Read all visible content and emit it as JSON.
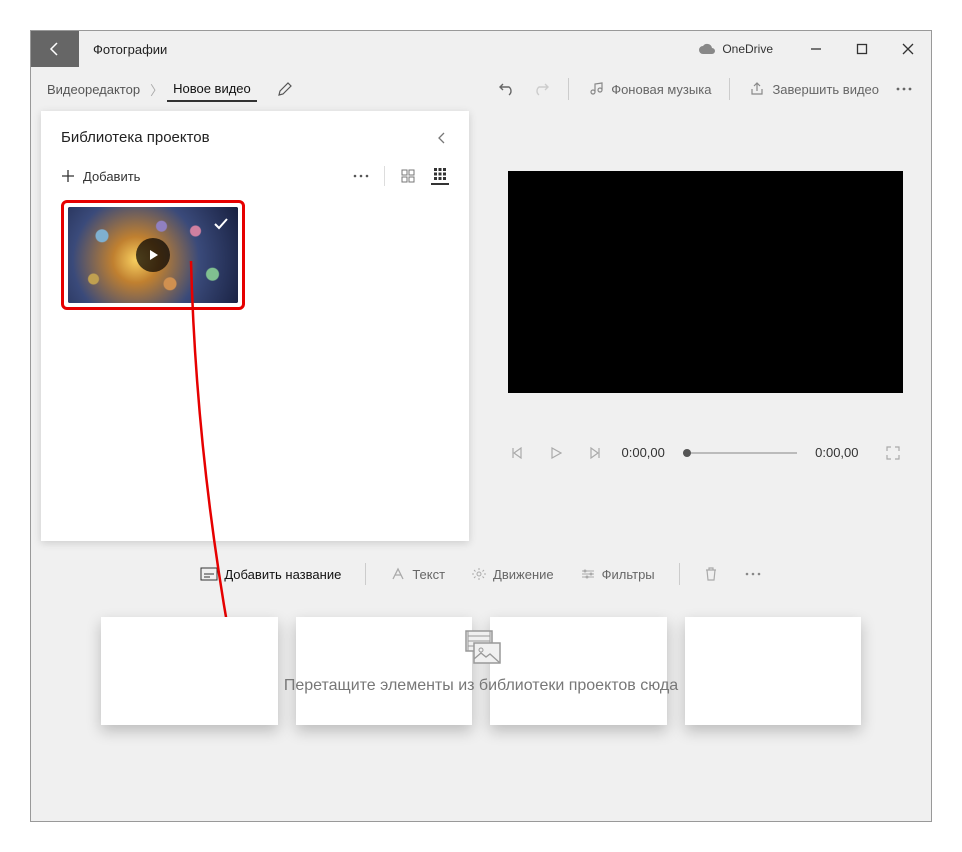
{
  "title": "Фотографии",
  "onedrive": "OneDrive",
  "breadcrumb": {
    "root": "Видеоредактор",
    "current": "Новое видео"
  },
  "toolbar": {
    "music": "Фоновая музыка",
    "finish": "Завершить видео"
  },
  "library": {
    "title": "Библиотека проектов",
    "add": "Добавить"
  },
  "player": {
    "time_current": "0:00,00",
    "time_total": "0:00,00"
  },
  "editbar": {
    "add_title": "Добавить название",
    "text": "Текст",
    "motion": "Движение",
    "filters": "Фильтры"
  },
  "timeline": {
    "hint": "Перетащите элементы из библиотеки проектов сюда"
  }
}
